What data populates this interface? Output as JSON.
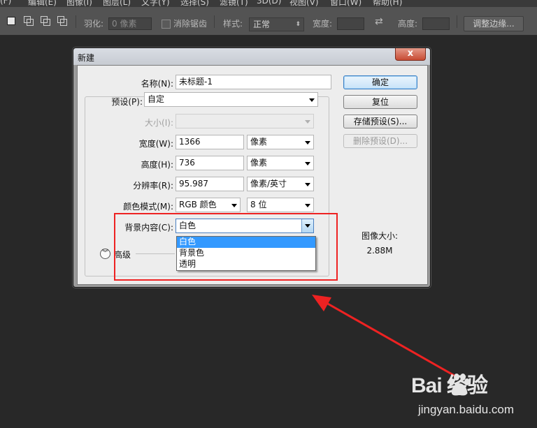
{
  "menu": [
    "(F)",
    "编辑(E)",
    "图像(I)",
    "图层(L)",
    "文字(Y)",
    "选择(S)",
    "滤镜(T)",
    "3D(D)",
    "视图(V)",
    "窗口(W)",
    "帮助(H)"
  ],
  "options": {
    "feather_label": "羽化:",
    "feather_value": "0 像素",
    "antialias_label": "消除锯齿",
    "style_label": "样式:",
    "style_value": "正常",
    "width_label": "宽度:",
    "height_label": "高度:",
    "refine_edge_button": "调整边缘..."
  },
  "dialog": {
    "title": "新建",
    "close_symbol": "x",
    "name_label": "名称(N):",
    "name_value": "未标题-1",
    "preset_label": "预设(P):",
    "preset_value": "自定",
    "size_label": "大小(I):",
    "width_label": "宽度(W):",
    "width_value": "1366",
    "width_unit": "像素",
    "height_label": "高度(H):",
    "height_value": "736",
    "height_unit": "像素",
    "resolution_label": "分辨率(R):",
    "resolution_value": "95.987",
    "resolution_unit": "像素/英寸",
    "color_mode_label": "颜色模式(M):",
    "color_mode_value": "RGB 颜色",
    "bit_depth_value": "8 位",
    "background_label": "背景内容(C):",
    "background_value": "白色",
    "background_options": [
      "白色",
      "背景色",
      "透明"
    ],
    "advanced_label": "高级",
    "image_size_label": "图像大小:",
    "image_size_value": "2.88M",
    "buttons": {
      "ok": "确定",
      "reset": "复位",
      "save_preset": "存储预设(S)...",
      "delete_preset": "删除预设(D)..."
    }
  },
  "watermark": {
    "logo": "Bai  经验",
    "site": "jingyan.baidu.com"
  },
  "colors": {
    "highlight": "#ee2222",
    "selection": "#3399ff",
    "workspace": "#282828"
  }
}
